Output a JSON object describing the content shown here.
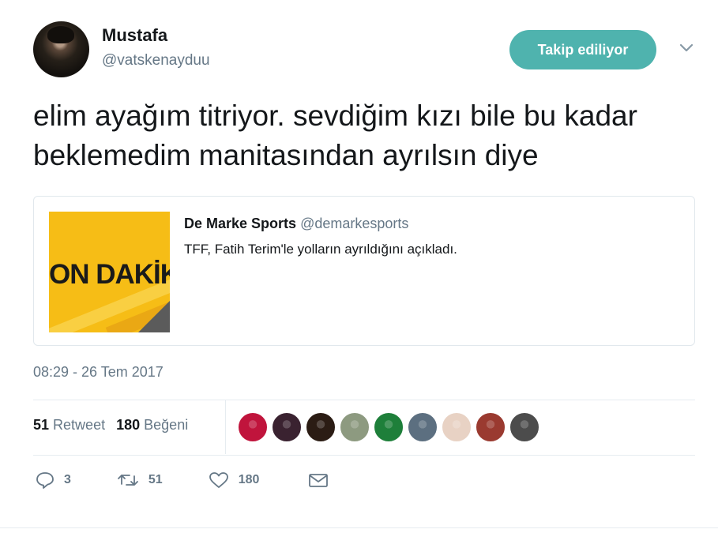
{
  "tweet": {
    "author_name": "Mustafa",
    "author_handle": "@vatskenayduu",
    "follow_button_label": "Takip ediliyor",
    "text": "elim ayağım titriyor. sevdiğim kızı bile bu kadar beklemedim manitasından ayrılsın diye",
    "timestamp": "08:29 - 26 Tem 2017"
  },
  "quoted_tweet": {
    "author_name": "De Marke Sports",
    "author_handle": "@demarkesports",
    "text": "TFF, Fatih Terim'le yolların ayrıldığını açıkladı.",
    "image_text": "ON DAKİK"
  },
  "stats": {
    "retweet_count": "51",
    "retweet_label": "Retweet",
    "like_count": "180",
    "like_label": "Beğeni"
  },
  "liker_avatars": [
    {
      "color": "#c0143c"
    },
    {
      "color": "#3a2230"
    },
    {
      "color": "#2b1c14"
    },
    {
      "color": "#8d9a80"
    },
    {
      "color": "#1e7f3a"
    },
    {
      "color": "#5c6f80"
    },
    {
      "color": "#e8d2c4"
    },
    {
      "color": "#9a3a30"
    },
    {
      "color": "#4c4c4c"
    }
  ],
  "actions": {
    "reply_count": "3",
    "retweet_count": "51",
    "like_count": "180"
  },
  "icons": {
    "reply": "reply-icon",
    "retweet": "retweet-icon",
    "like": "heart-icon",
    "dm": "envelope-icon",
    "more": "chevron-down-icon"
  },
  "colors": {
    "accent": "#4fb3ae",
    "secondary_text": "#657786",
    "border": "#e6ecf0",
    "image_yellow": "#f6bd16"
  }
}
